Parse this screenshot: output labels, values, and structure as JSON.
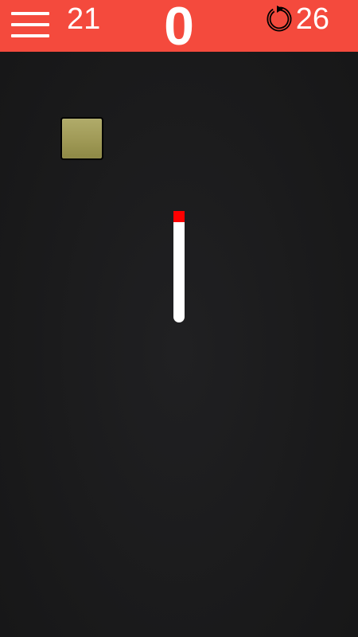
{
  "header": {
    "level_count": "21",
    "score": "0",
    "restarts": "26",
    "accent_color": "#f44a3d",
    "menu_icon": "hamburger-menu-icon",
    "restart_icon": "restart-arrow-icon"
  },
  "game": {
    "block_color": "#a19b58",
    "bar_color": "#ffffff",
    "bar_tip_color": "#ff0000",
    "background_color": "#1b1b1c"
  }
}
